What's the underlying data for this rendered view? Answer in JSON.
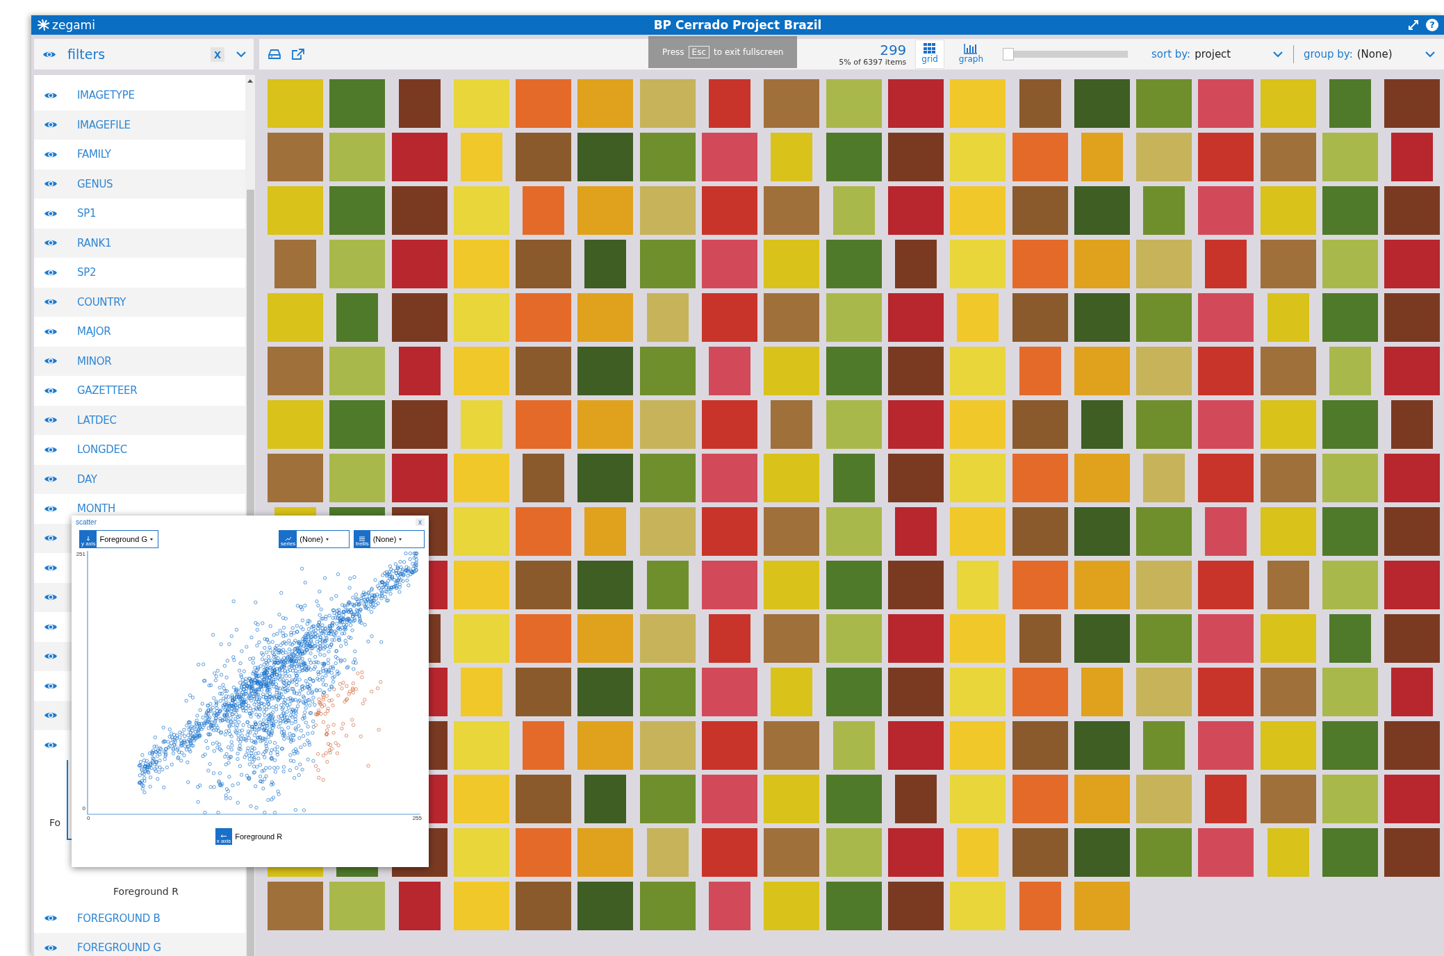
{
  "window": {
    "title": "BP Cerrado Project Brazil",
    "logo": "zegami",
    "help": "?"
  },
  "fullscreen_hint": {
    "before": "Press",
    "key": "Esc",
    "after": "to exit fullscreen"
  },
  "filters": {
    "title": "filters",
    "clear": "x",
    "items": [
      {
        "kind": "field",
        "label": "IMAGETYPE"
      },
      {
        "kind": "field",
        "label": "IMAGEFILE"
      },
      {
        "kind": "field",
        "label": "FAMILY"
      },
      {
        "kind": "field",
        "label": "GENUS"
      },
      {
        "kind": "field",
        "label": "SP1"
      },
      {
        "kind": "field",
        "label": "RANK1"
      },
      {
        "kind": "field",
        "label": "SP2"
      },
      {
        "kind": "field",
        "label": "COUNTRY"
      },
      {
        "kind": "field",
        "label": "MAJOR"
      },
      {
        "kind": "field",
        "label": "MINOR"
      },
      {
        "kind": "field",
        "label": "GAZETTEER"
      },
      {
        "kind": "field",
        "label": "LATDEC"
      },
      {
        "kind": "field",
        "label": "LONGDEC"
      },
      {
        "kind": "field",
        "label": "DAY"
      },
      {
        "kind": "field",
        "label": "MONTH"
      },
      {
        "kind": "covered"
      },
      {
        "kind": "covered"
      },
      {
        "kind": "covered"
      },
      {
        "kind": "covered"
      },
      {
        "kind": "covered"
      },
      {
        "kind": "covered"
      },
      {
        "kind": "covered"
      },
      {
        "kind": "covered"
      },
      {
        "kind": "chart",
        "ylabel": "Fo",
        "xlabel": "Foreground R"
      },
      {
        "kind": "field",
        "label": "FOREGROUND B"
      },
      {
        "kind": "field",
        "label": "FOREGROUND G"
      }
    ]
  },
  "toolbar": {
    "count": "299",
    "subcount": "5% of 6397 items",
    "views": [
      {
        "label": "grid",
        "selected": true
      },
      {
        "label": "graph",
        "selected": false
      }
    ],
    "zoom": {
      "level": 0.0
    },
    "sort": {
      "label": "sort by:",
      "value": "project"
    },
    "group": {
      "label": "group by:",
      "value": "(None)"
    }
  },
  "scatter": {
    "title": "scatter",
    "close": "x",
    "y_axis": {
      "tag": "y axis",
      "value": "Foreground G"
    },
    "series": {
      "tag": "series",
      "value": "(None)"
    },
    "trellis": {
      "tag": "trellis",
      "value": "(None)"
    },
    "x_axis": {
      "tag": "x axis",
      "value": "Foreground R"
    },
    "y_ticks": [
      "251",
      "0"
    ],
    "x_ticks": [
      "0",
      "255"
    ]
  }
}
